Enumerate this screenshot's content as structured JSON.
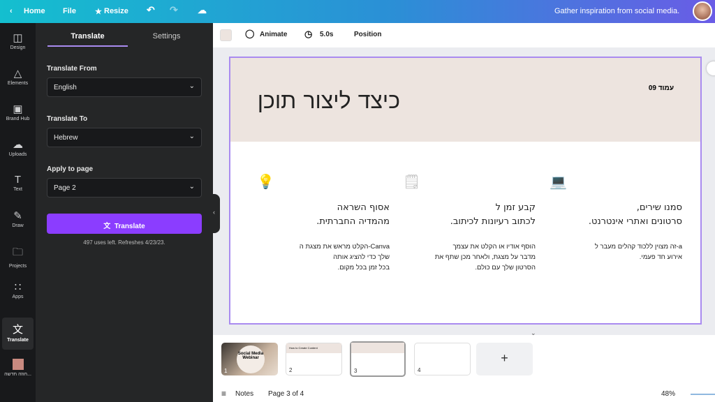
{
  "topbar": {
    "home": "Home",
    "file": "File",
    "resize": "Resize",
    "inspiration": "Gather inspiration from social media."
  },
  "rail": [
    {
      "label": "Design",
      "icon": "layout-icon"
    },
    {
      "label": "Elements",
      "icon": "shapes-icon"
    },
    {
      "label": "Brand Hub",
      "icon": "brand-icon"
    },
    {
      "label": "Uploads",
      "icon": "cloud-upload-icon"
    },
    {
      "label": "Text",
      "icon": "text-icon"
    },
    {
      "label": "Draw",
      "icon": "pen-icon"
    },
    {
      "label": "Projects",
      "icon": "folder-icon"
    },
    {
      "label": "Apps",
      "icon": "grid-icon"
    },
    {
      "label": "Translate",
      "icon": "translate-icon"
    },
    {
      "label": "חוזה חדשה..."
    }
  ],
  "panel": {
    "tabs": [
      "Translate",
      "Settings"
    ],
    "from_label": "Translate From",
    "from_value": "English",
    "to_label": "Translate To",
    "to_value": "Hebrew",
    "page_label": "Apply to page",
    "page_value": "Page 2",
    "button": "Translate",
    "uses": "497 uses left. Refreshes 4/23/23."
  },
  "toolbar": {
    "animate": "Animate",
    "duration": "5.0s",
    "position": "Position"
  },
  "slide": {
    "title": "כיצד ליצור תוכן",
    "page": "עמוד 09",
    "columns": [
      {
        "icon": "monitor-icon",
        "heading1": "סמנו שירים,",
        "heading2": "סרטונים ואתרי אינטרנט.",
        "body": [
          "a-זה מצוין ללכוד קהלים מעבר ל",
          "אירוע חד פעמי."
        ]
      },
      {
        "icon": "notepad-icon",
        "heading1": "קבע זמן ל",
        "heading2": "לכתוב רעיונות לכיתוב.",
        "body": [
          "הוסף אודיו או הקלט את עצמך",
          "מדבר על מצגת, ולאחר מכן שתף את",
          "הסרטון שלך עם כולם."
        ]
      },
      {
        "icon": "lightbulb-icon",
        "heading1": "אסוף השראה",
        "heading2": "מהמדיה החברתית.",
        "body": [
          "Canva-הקלט מראש את מצגת ה",
          "שלך כדי להציג אותה",
          "בכל זמן בכל מקום."
        ]
      }
    ]
  },
  "thumbnails": [
    {
      "n": "1",
      "text": "Social Media Webinar"
    },
    {
      "n": "2",
      "text": "How to Create Content"
    },
    {
      "n": "3"
    },
    {
      "n": "4"
    }
  ],
  "bottom": {
    "notes": "Notes",
    "page": "Page 3 of 4",
    "zoom": "48%"
  },
  "colors": {
    "accent": "#8b3dff",
    "selection": "#a98bf0",
    "slide_header": "#ede4df"
  }
}
